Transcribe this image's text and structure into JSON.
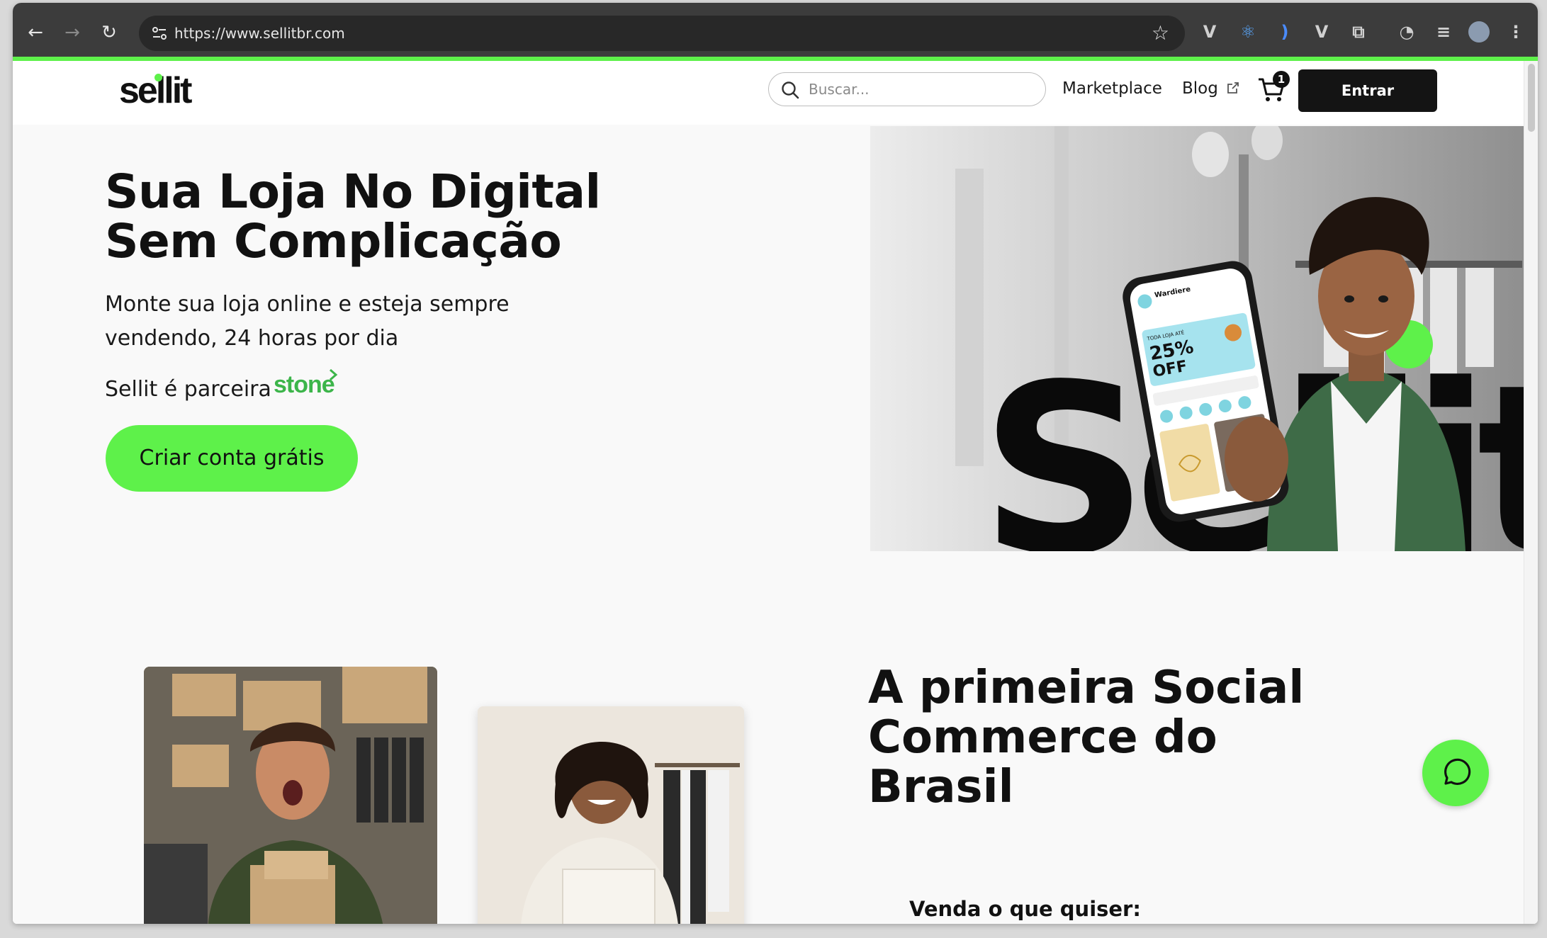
{
  "browser": {
    "url": "https://www.sellitbr.com"
  },
  "header": {
    "logo_text": "sellit",
    "search_placeholder": "Buscar...",
    "nav": {
      "marketplace": "Marketplace",
      "blog": "Blog"
    },
    "cart_count": "1",
    "login_label": "Entrar"
  },
  "hero": {
    "title_line1": "Sua Loja No Digital",
    "title_line2": "Sem Complicação",
    "subtitle": "Monte sua loja online e esteja sempre vendendo, 24 horas por dia",
    "partner_text": "Sellit é parceira",
    "partner_logo": "stone",
    "cta_label": "Criar conta grátis",
    "image_wordmark": "Sellit",
    "phone": {
      "store_name": "Wardiere",
      "promo_top": "TODA LOJA ATÉ",
      "promo_value": "25%",
      "promo_off": "OFF"
    }
  },
  "section": {
    "title": "A primeira Social Commerce do Brasil",
    "subtitle": "Venda o que quiser:"
  },
  "colors": {
    "brand_green": "#5ef14a",
    "dark": "#141414",
    "stone_green": "#3cb54a"
  }
}
